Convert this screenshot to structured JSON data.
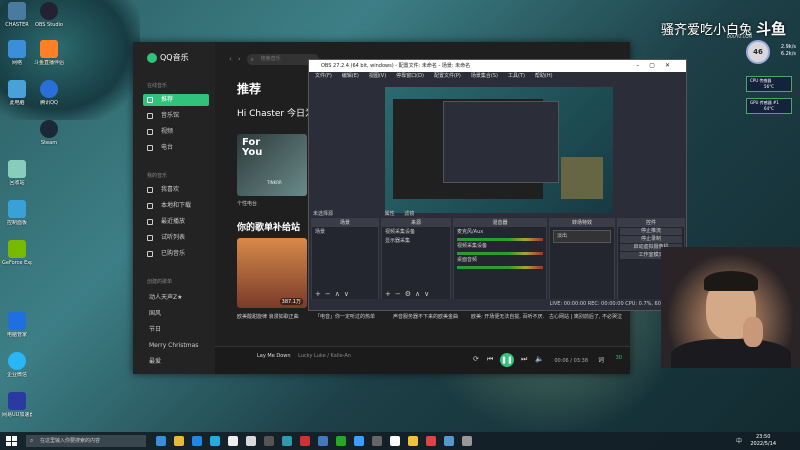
{
  "desktop": {
    "icons": [
      {
        "label": "CHASTER",
        "color": "#4a7aa0"
      },
      {
        "label": "OBS Studio",
        "color": "#222233"
      },
      {
        "label": "网络",
        "color": "#3a8fd8"
      },
      {
        "label": "斗鱼直播伴侣",
        "color": "#ff7f27"
      },
      {
        "label": "此电脑",
        "color": "#4aa0d8"
      },
      {
        "label": "腾讯QQ",
        "color": "#2a6fd8"
      },
      {
        "label": "Steam",
        "color": "#1b2838"
      },
      {
        "label": "回收站",
        "color": "#8cb"
      },
      {
        "label": "控制面板",
        "color": "#3aa0d8"
      },
      {
        "label": "GeForce Experience",
        "color": "#76b900"
      },
      {
        "label": "电脑管家",
        "color": "#1f6fe0"
      },
      {
        "label": "企业微信",
        "color": "#29b6f6"
      },
      {
        "label": "网易UU加速器",
        "color": "#2a3aa0"
      }
    ]
  },
  "brand": {
    "streamer": "骚齐爱吃小白兔",
    "platform": "斗鱼",
    "platform_sub": "DOUYU.COM",
    "gauge": "46",
    "net_up": "2.9k/s",
    "net_down": "6.2k/s",
    "cpu_label": "CPU 传感器",
    "cpu_value": "56°C",
    "gpu_label": "GPU 传感器 #1",
    "gpu_value": "64°C"
  },
  "qqmusic": {
    "app_name": "QQ音乐",
    "sections": {
      "online": "在线音乐",
      "my_music": "我的音乐",
      "created": "创建的歌单"
    },
    "online_items": [
      "推荐",
      "音乐馆",
      "视频",
      "电台"
    ],
    "my_items": [
      "我喜欢",
      "本地和下载",
      "最近播放",
      "试听列表",
      "已购音乐"
    ],
    "playlists": [
      "动人天声Z★",
      "国风",
      "节日",
      "Merry Christmas",
      "最爱"
    ],
    "search_placeholder": "搜索音乐",
    "user": "Chaster",
    "title": "推荐",
    "greeting": "Hi Chaster 今日为",
    "card1_text": "For You",
    "card1_sub": "TINKRR",
    "card1_caption": "个性电台",
    "section_title": "你的歌单补给站",
    "tiles": [
      {
        "caption": "欧美酸甜旋律 浪漫如歌正曲",
        "play": "387.1万",
        "color": "#c05a3a"
      },
      {
        "caption": "「电音」你一定听过的热单",
        "play": "",
        "color": "#3a3a48"
      },
      {
        "caption": "声音服务器不下来的欧美金曲",
        "play": "",
        "color": "#4a4a58"
      },
      {
        "caption": "欧美: 开场便无法自拔, 百听不厌.",
        "play": "",
        "color": "#2a4a68"
      },
      {
        "caption": "古心网站 | 离别前后了, 不必哭泣",
        "play": "",
        "color": "#486"
      }
    ],
    "player": {
      "song": "Lay Me Down",
      "artist": "Lucky Luke / Kalie-An",
      "time": "00:06 / 03:38",
      "lyric_btn": "词",
      "count": "30"
    }
  },
  "obs": {
    "title": "OBS 27.2.4 (64 bit, windows) - 配置文件: 未命名 - 场景: 未命名",
    "menu": [
      "文件(F)",
      "编辑(E)",
      "视图(V)",
      "停靠窗口(D)",
      "配置文件(P)",
      "场景集合(S)",
      "工具(T)",
      "帮助(H)"
    ],
    "no_source": "未选择源",
    "props_btn": "属性",
    "filter_btn": "滤镜",
    "docks": {
      "scenes": "场景",
      "sources": "来源",
      "mixer": "混音器",
      "transitions": "转场特效",
      "controls": "控件"
    },
    "scene_item": "场景",
    "source_items": [
      "视频采集设备",
      "显示器采集"
    ],
    "mixer_items": [
      "麦克风/Aux",
      "视频采集设备",
      "桌面音频"
    ],
    "mixer_db": "0.0 dB",
    "transition": "淡出",
    "control_items": [
      "停止推流",
      "停止录制",
      "启动虚拟摄像机",
      "工作室模式",
      "设置",
      "退出"
    ],
    "status": "LIVE: 00:00:00   REC: 00:00:00   CPU: 0.7%, 60.00 fps"
  },
  "taskbar": {
    "search_placeholder": "在这里输入你要搜索的内容",
    "time": "23:50",
    "date": "2022/5/14",
    "lang": "中",
    "apps": [
      "#3a8fd8",
      "#e8b840",
      "#1e88e5",
      "#2aa8e0",
      "#eee",
      "#d9d9d9",
      "#555",
      "#39a",
      "#c33",
      "#47b",
      "#2a2",
      "#3aa0ff",
      "#666",
      "#fff",
      "#f0c040",
      "#d44",
      "#59c",
      "#999"
    ]
  }
}
